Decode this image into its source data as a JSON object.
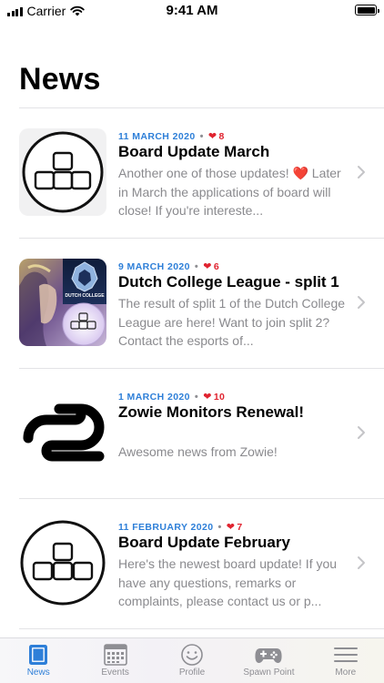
{
  "status_bar": {
    "carrier": "Carrier",
    "time": "9:41 AM"
  },
  "page": {
    "title": "News"
  },
  "colors": {
    "accent": "#2e7fd8",
    "like": "#e0232f",
    "secondary_text": "#8a8a8e"
  },
  "news": [
    {
      "date": "11 MARCH 2020",
      "likes": "8",
      "title": "Board Update March",
      "summary": "Another one of those updates! ❤️ Later in March the applications of board will close! If you're intereste...",
      "thumbnail": "keyboard-logo"
    },
    {
      "date": "9 MARCH 2020",
      "likes": "6",
      "title": "Dutch College League - split 1",
      "summary": "The result of split 1 of the Dutch College League are here! Want to join split 2? Contact the esports of...",
      "thumbnail": "dutch-college-league-collage",
      "thumbnail_caption": "DUTCH COLLEGE"
    },
    {
      "date": "1 MARCH 2020",
      "likes": "10",
      "title": "Zowie Monitors Renewal!",
      "summary": "Awesome news from Zowie!",
      "thumbnail": "zowie-logo"
    },
    {
      "date": "11 FEBRUARY 2020",
      "likes": "7",
      "title": "Board Update February",
      "summary": "Here's the newest board update! If you have any questions, remarks or complaints, please contact us or p...",
      "thumbnail": "keyboard-logo"
    }
  ],
  "tabs": [
    {
      "label": "News",
      "icon": "news-icon",
      "active": true
    },
    {
      "label": "Events",
      "icon": "calendar-icon",
      "active": false
    },
    {
      "label": "Profile",
      "icon": "smiley-icon",
      "active": false
    },
    {
      "label": "Spawn Point",
      "icon": "gamepad-icon",
      "active": false
    },
    {
      "label": "More",
      "icon": "menu-icon",
      "active": false
    }
  ]
}
